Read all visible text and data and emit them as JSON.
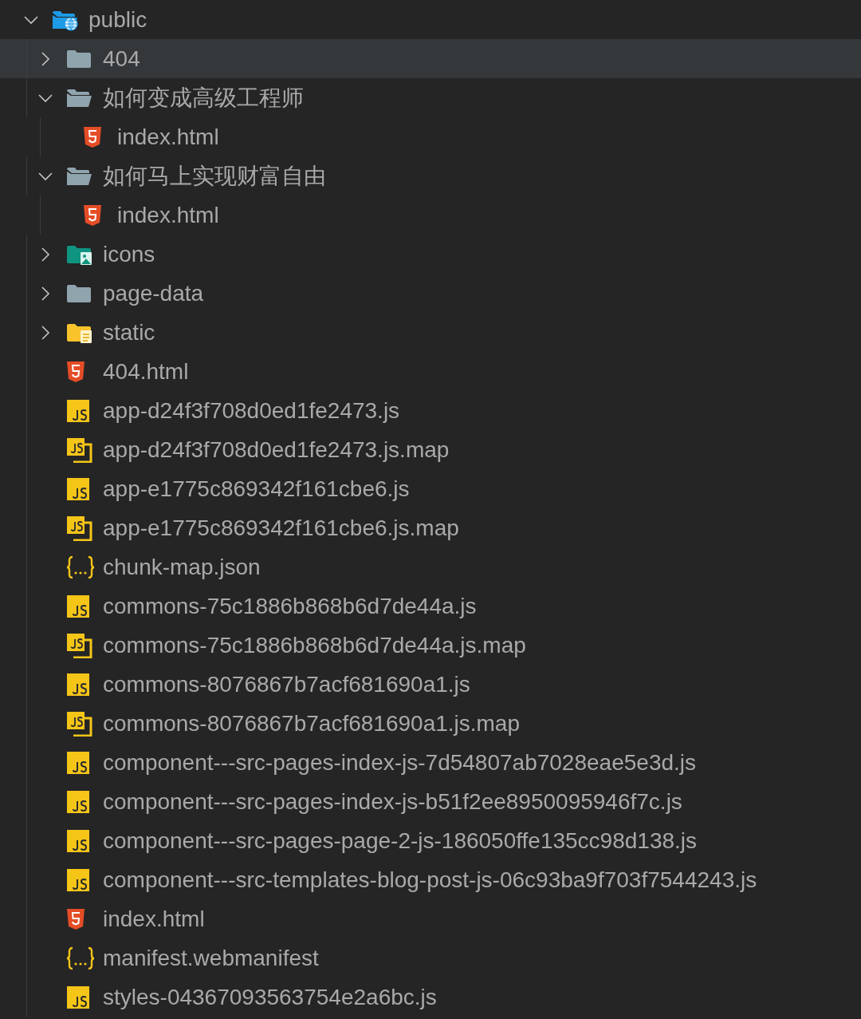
{
  "explorer": {
    "tree": [
      {
        "label": "public",
        "kind": "folder-web",
        "expanded": true,
        "selected": false,
        "children": [
          {
            "label": "404",
            "kind": "folder",
            "expanded": false,
            "selected": true
          },
          {
            "label": "如何变成高级工程师",
            "kind": "folder",
            "expanded": true,
            "selected": false,
            "children": [
              {
                "label": "index.html",
                "kind": "html",
                "selected": false
              }
            ]
          },
          {
            "label": "如何马上实现财富自由",
            "kind": "folder",
            "expanded": true,
            "selected": false,
            "children": [
              {
                "label": "index.html",
                "kind": "html",
                "selected": false
              }
            ]
          },
          {
            "label": "icons",
            "kind": "folder-images",
            "expanded": false,
            "selected": false
          },
          {
            "label": "page-data",
            "kind": "folder",
            "expanded": false,
            "selected": false
          },
          {
            "label": "static",
            "kind": "folder-static",
            "expanded": false,
            "selected": false
          },
          {
            "label": "404.html",
            "kind": "html",
            "selected": false
          },
          {
            "label": "app-d24f3f708d0ed1fe2473.js",
            "kind": "js",
            "selected": false
          },
          {
            "label": "app-d24f3f708d0ed1fe2473.js.map",
            "kind": "js-map",
            "selected": false
          },
          {
            "label": "app-e1775c869342f161cbe6.js",
            "kind": "js",
            "selected": false
          },
          {
            "label": "app-e1775c869342f161cbe6.js.map",
            "kind": "js-map",
            "selected": false
          },
          {
            "label": "chunk-map.json",
            "kind": "json",
            "selected": false
          },
          {
            "label": "commons-75c1886b868b6d7de44a.js",
            "kind": "js",
            "selected": false
          },
          {
            "label": "commons-75c1886b868b6d7de44a.js.map",
            "kind": "js-map",
            "selected": false
          },
          {
            "label": "commons-8076867b7acf681690a1.js",
            "kind": "js",
            "selected": false
          },
          {
            "label": "commons-8076867b7acf681690a1.js.map",
            "kind": "js-map",
            "selected": false
          },
          {
            "label": "component---src-pages-index-js-7d54807ab7028eae5e3d.js",
            "kind": "js",
            "selected": false
          },
          {
            "label": "component---src-pages-index-js-b51f2ee8950095946f7c.js",
            "kind": "js",
            "selected": false
          },
          {
            "label": "component---src-pages-page-2-js-186050ffe135cc98d138.js",
            "kind": "js",
            "selected": false
          },
          {
            "label": "component---src-templates-blog-post-js-06c93ba9f703f7544243.js",
            "kind": "js",
            "selected": false
          },
          {
            "label": "index.html",
            "kind": "html",
            "selected": false
          },
          {
            "label": "manifest.webmanifest",
            "kind": "json",
            "selected": false
          },
          {
            "label": "styles-04367093563754e2a6bc.js",
            "kind": "js",
            "selected": false
          }
        ]
      }
    ]
  }
}
